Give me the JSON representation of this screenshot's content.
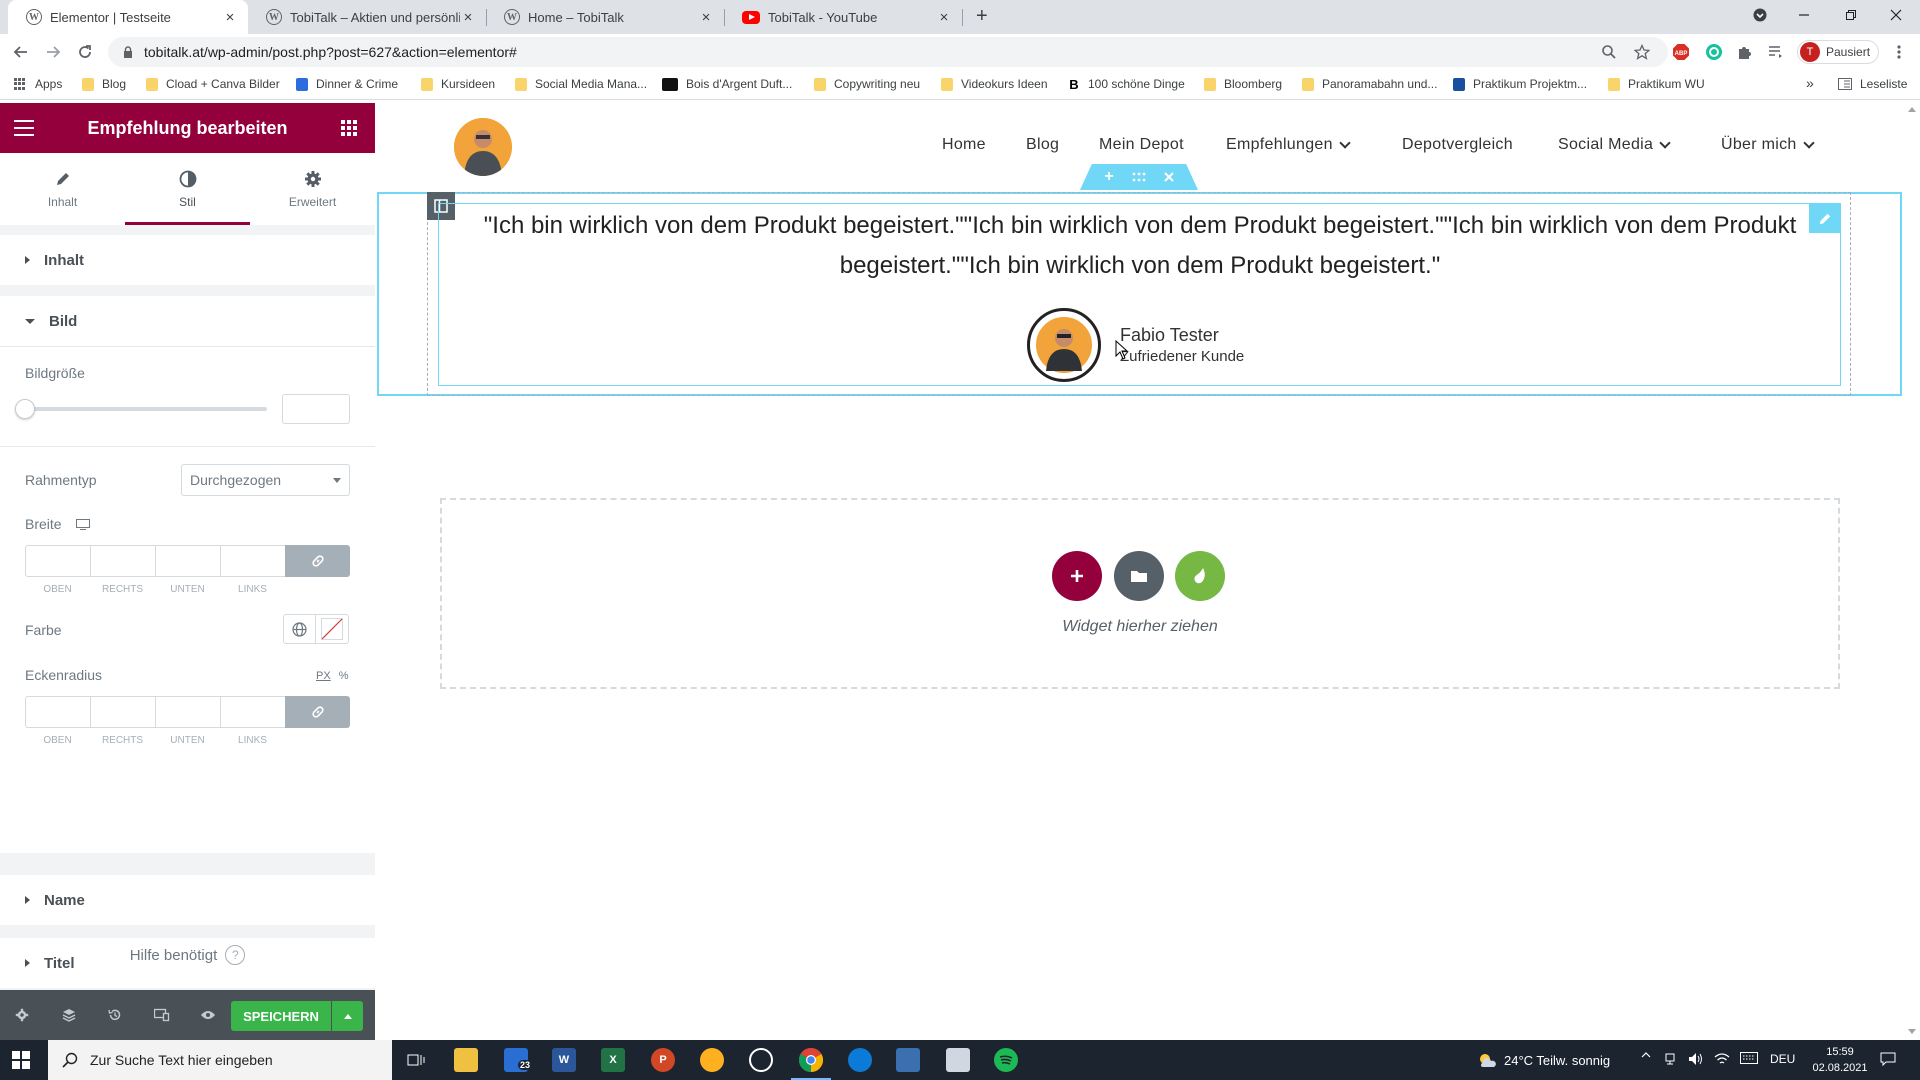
{
  "browser": {
    "tabs": [
      {
        "label": "Elementor | Testseite",
        "icon": "wordpress-icon",
        "active": true
      },
      {
        "label": "TobiTalk – Aktien und persönliche",
        "icon": "wordpress-icon",
        "active": false
      },
      {
        "label": "Home – TobiTalk",
        "icon": "wordpress-icon",
        "active": false
      },
      {
        "label": "TobiTalk - YouTube",
        "icon": "youtube-icon",
        "active": false
      }
    ],
    "new_tab": "+",
    "url": "tobitalk.at/wp-admin/post.php?post=627&action=elementor#",
    "profile": {
      "initial": "T",
      "label": "Pausiert"
    },
    "bookmarks": [
      {
        "label": "Apps",
        "icon": "apps-grid-icon"
      },
      {
        "label": "Blog",
        "icon": "folder-icon"
      },
      {
        "label": "Cload + Canva Bilder",
        "icon": "folder-icon"
      },
      {
        "label": "Dinner & Crime",
        "icon": "jd-favicon"
      },
      {
        "label": "Kursideen",
        "icon": "folder-icon"
      },
      {
        "label": "Social Media Mana...",
        "icon": "folder-icon"
      },
      {
        "label": "Bois d'Argent Duft...",
        "icon": "bois-favicon"
      },
      {
        "label": "Copywriting neu",
        "icon": "folder-icon"
      },
      {
        "label": "Videokurs Ideen",
        "icon": "folder-icon"
      },
      {
        "label": "100 schöne Dinge",
        "icon": "b-favicon"
      },
      {
        "label": "Bloomberg",
        "icon": "folder-icon"
      },
      {
        "label": "Panoramabahn und...",
        "icon": "folder-icon"
      },
      {
        "label": "Praktikum Projektm...",
        "icon": "j-favicon"
      },
      {
        "label": "Praktikum WU",
        "icon": "folder-icon"
      }
    ],
    "more_bookmarks": "»",
    "reading_list": "Leseliste"
  },
  "panel": {
    "title": "Empfehlung bearbeiten",
    "tabs": [
      {
        "label": "Inhalt",
        "icon": "pencil-icon"
      },
      {
        "label": "Stil",
        "icon": "half-circle-icon"
      },
      {
        "label": "Erweitert",
        "icon": "gear-icon"
      }
    ],
    "sections": {
      "inhalt": "Inhalt",
      "bild": "Bild",
      "name": "Name",
      "titel": "Titel"
    },
    "bild": {
      "bildgroesse_label": "Bildgröße",
      "bildgroesse_value": "",
      "rahmentyp_label": "Rahmentyp",
      "rahmentyp_value": "Durchgezogen",
      "breite_label": "Breite",
      "farbe_label": "Farbe",
      "eckenradius_label": "Eckenradius",
      "units": [
        "PX",
        "%"
      ],
      "dim_labels": [
        "OBEN",
        "RECHTS",
        "UNTEN",
        "LINKS"
      ]
    },
    "help": "Hilfe benötigt",
    "help_icon": "?",
    "save": "SPEICHERN"
  },
  "site": {
    "nav": [
      {
        "label": "Home",
        "dropdown": false
      },
      {
        "label": "Blog",
        "dropdown": false
      },
      {
        "label": "Mein Depot",
        "dropdown": false
      },
      {
        "label": "Empfehlungen",
        "dropdown": true
      },
      {
        "label": "Depotvergleich",
        "dropdown": false
      },
      {
        "label": "Social Media",
        "dropdown": true
      },
      {
        "label": "Über mich",
        "dropdown": true
      }
    ],
    "testimonial": {
      "quote": "\"Ich bin wirklich von dem Produkt begeistert.\"\"Ich bin wirklich von dem Produkt begeistert.\"\"Ich bin wirklich von dem Produkt begeistert.\"\"Ich bin wirklich von dem Produkt begeistert.\"",
      "name": "Fabio Tester",
      "title": "Zufriedener Kunde"
    },
    "dropzone_text": "Widget hierher ziehen"
  },
  "taskbar": {
    "search_placeholder": "Zur Suche Text hier eingeben",
    "mail_badge": "23",
    "weather": "24°C  Teilw. sonnig",
    "lang": "DEU",
    "time": "15:59",
    "date": "02.08.2021"
  },
  "colors": {
    "elementor_primary": "#93003c",
    "save_green": "#39b54a",
    "selection_cyan": "#71d7f7",
    "dropzone_add": "#93003c",
    "dropzone_folder": "#556068",
    "dropzone_kit": "#76b843"
  }
}
